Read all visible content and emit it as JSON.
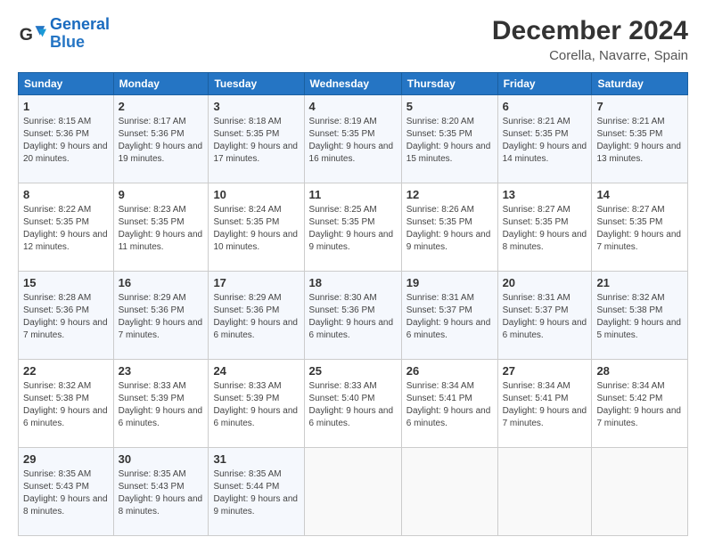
{
  "header": {
    "logo_general": "General",
    "logo_blue": "Blue",
    "month_title": "December 2024",
    "location": "Corella, Navarre, Spain"
  },
  "days_of_week": [
    "Sunday",
    "Monday",
    "Tuesday",
    "Wednesday",
    "Thursday",
    "Friday",
    "Saturday"
  ],
  "weeks": [
    [
      {
        "day": "1",
        "sunrise": "8:15 AM",
        "sunset": "5:36 PM",
        "daylight": "9 hours and 20 minutes."
      },
      {
        "day": "2",
        "sunrise": "8:17 AM",
        "sunset": "5:36 PM",
        "daylight": "9 hours and 19 minutes."
      },
      {
        "day": "3",
        "sunrise": "8:18 AM",
        "sunset": "5:35 PM",
        "daylight": "9 hours and 17 minutes."
      },
      {
        "day": "4",
        "sunrise": "8:19 AM",
        "sunset": "5:35 PM",
        "daylight": "9 hours and 16 minutes."
      },
      {
        "day": "5",
        "sunrise": "8:20 AM",
        "sunset": "5:35 PM",
        "daylight": "9 hours and 15 minutes."
      },
      {
        "day": "6",
        "sunrise": "8:21 AM",
        "sunset": "5:35 PM",
        "daylight": "9 hours and 14 minutes."
      },
      {
        "day": "7",
        "sunrise": "8:21 AM",
        "sunset": "5:35 PM",
        "daylight": "9 hours and 13 minutes."
      }
    ],
    [
      {
        "day": "8",
        "sunrise": "8:22 AM",
        "sunset": "5:35 PM",
        "daylight": "9 hours and 12 minutes."
      },
      {
        "day": "9",
        "sunrise": "8:23 AM",
        "sunset": "5:35 PM",
        "daylight": "9 hours and 11 minutes."
      },
      {
        "day": "10",
        "sunrise": "8:24 AM",
        "sunset": "5:35 PM",
        "daylight": "9 hours and 10 minutes."
      },
      {
        "day": "11",
        "sunrise": "8:25 AM",
        "sunset": "5:35 PM",
        "daylight": "9 hours and 9 minutes."
      },
      {
        "day": "12",
        "sunrise": "8:26 AM",
        "sunset": "5:35 PM",
        "daylight": "9 hours and 9 minutes."
      },
      {
        "day": "13",
        "sunrise": "8:27 AM",
        "sunset": "5:35 PM",
        "daylight": "9 hours and 8 minutes."
      },
      {
        "day": "14",
        "sunrise": "8:27 AM",
        "sunset": "5:35 PM",
        "daylight": "9 hours and 7 minutes."
      }
    ],
    [
      {
        "day": "15",
        "sunrise": "8:28 AM",
        "sunset": "5:36 PM",
        "daylight": "9 hours and 7 minutes."
      },
      {
        "day": "16",
        "sunrise": "8:29 AM",
        "sunset": "5:36 PM",
        "daylight": "9 hours and 7 minutes."
      },
      {
        "day": "17",
        "sunrise": "8:29 AM",
        "sunset": "5:36 PM",
        "daylight": "9 hours and 6 minutes."
      },
      {
        "day": "18",
        "sunrise": "8:30 AM",
        "sunset": "5:36 PM",
        "daylight": "9 hours and 6 minutes."
      },
      {
        "day": "19",
        "sunrise": "8:31 AM",
        "sunset": "5:37 PM",
        "daylight": "9 hours and 6 minutes."
      },
      {
        "day": "20",
        "sunrise": "8:31 AM",
        "sunset": "5:37 PM",
        "daylight": "9 hours and 6 minutes."
      },
      {
        "day": "21",
        "sunrise": "8:32 AM",
        "sunset": "5:38 PM",
        "daylight": "9 hours and 5 minutes."
      }
    ],
    [
      {
        "day": "22",
        "sunrise": "8:32 AM",
        "sunset": "5:38 PM",
        "daylight": "9 hours and 6 minutes."
      },
      {
        "day": "23",
        "sunrise": "8:33 AM",
        "sunset": "5:39 PM",
        "daylight": "9 hours and 6 minutes."
      },
      {
        "day": "24",
        "sunrise": "8:33 AM",
        "sunset": "5:39 PM",
        "daylight": "9 hours and 6 minutes."
      },
      {
        "day": "25",
        "sunrise": "8:33 AM",
        "sunset": "5:40 PM",
        "daylight": "9 hours and 6 minutes."
      },
      {
        "day": "26",
        "sunrise": "8:34 AM",
        "sunset": "5:41 PM",
        "daylight": "9 hours and 6 minutes."
      },
      {
        "day": "27",
        "sunrise": "8:34 AM",
        "sunset": "5:41 PM",
        "daylight": "9 hours and 7 minutes."
      },
      {
        "day": "28",
        "sunrise": "8:34 AM",
        "sunset": "5:42 PM",
        "daylight": "9 hours and 7 minutes."
      }
    ],
    [
      {
        "day": "29",
        "sunrise": "8:35 AM",
        "sunset": "5:43 PM",
        "daylight": "9 hours and 8 minutes."
      },
      {
        "day": "30",
        "sunrise": "8:35 AM",
        "sunset": "5:43 PM",
        "daylight": "9 hours and 8 minutes."
      },
      {
        "day": "31",
        "sunrise": "8:35 AM",
        "sunset": "5:44 PM",
        "daylight": "9 hours and 9 minutes."
      },
      null,
      null,
      null,
      null
    ]
  ],
  "labels": {
    "sunrise": "Sunrise:",
    "sunset": "Sunset:",
    "daylight": "Daylight:"
  }
}
